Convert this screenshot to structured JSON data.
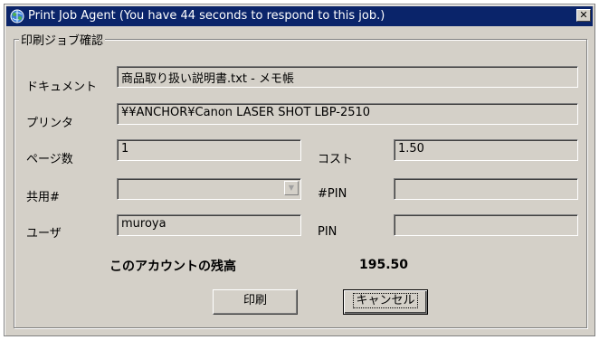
{
  "window": {
    "title": "Print Job Agent (You have 44 seconds to respond to this job.)",
    "close_glyph": "✕",
    "icon": "printer-globe-icon"
  },
  "group": {
    "title": "印刷ジョブ確認"
  },
  "fields": {
    "document": {
      "label": "ドキュメント",
      "value": "商品取り扱い説明書.txt - メモ帳"
    },
    "printer": {
      "label": "プリンタ",
      "value": "¥¥ANCHOR¥Canon LASER SHOT LBP-2510"
    },
    "pages": {
      "label": "ページ数",
      "value": "1"
    },
    "cost": {
      "label": "コスト",
      "value": "1.50"
    },
    "shared": {
      "label": "共用#",
      "value": ""
    },
    "pin_hash": {
      "label": "#PIN",
      "value": ""
    },
    "user": {
      "label": "ユーザ",
      "value": "muroya"
    },
    "pin": {
      "label": "PIN",
      "value": ""
    }
  },
  "balance": {
    "label": "このアカウントの残高",
    "value": "195.50"
  },
  "buttons": {
    "print": "印刷",
    "cancel": "キャンセル"
  }
}
